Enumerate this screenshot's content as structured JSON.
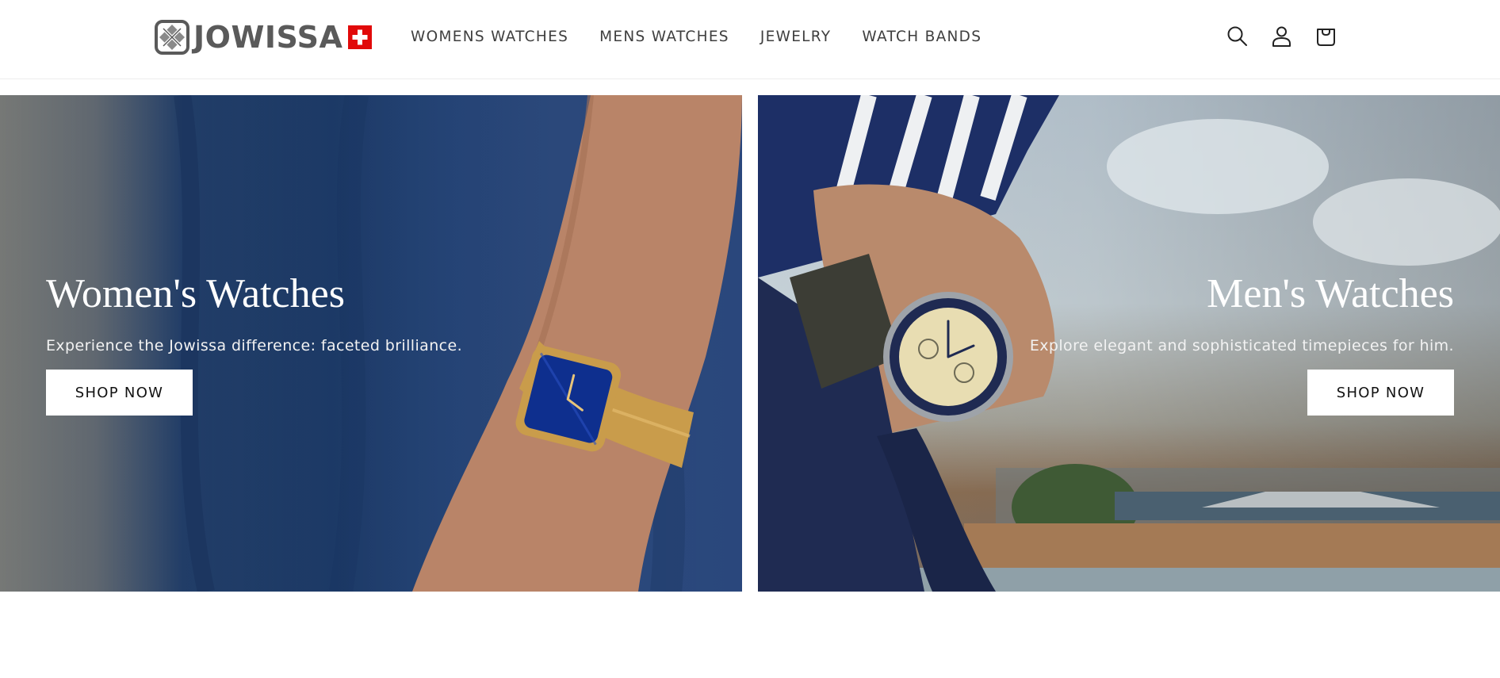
{
  "brand": {
    "name": "JOWISSA",
    "logo_icon": "crossed-diamond-logo",
    "flag_icon": "swiss-flag-icon",
    "flag_color": "#e10a0a",
    "logo_color": "#5a5a5a"
  },
  "nav": {
    "items": [
      {
        "label": "WOMENS WATCHES"
      },
      {
        "label": "MENS WATCHES"
      },
      {
        "label": "JEWELRY"
      },
      {
        "label": "WATCH BANDS"
      }
    ]
  },
  "header_icons": [
    "search-icon",
    "account-icon",
    "cart-icon"
  ],
  "hero": {
    "women": {
      "title": "Women's Watches",
      "subtitle": "Experience the Jowissa difference: faceted brilliance.",
      "button": "SHOP NOW"
    },
    "men": {
      "title": "Men's Watches",
      "subtitle": "Explore elegant and sophisticated timepieces for him.",
      "button": "SHOP NOW"
    }
  },
  "colors": {
    "text": "#121212",
    "nav_text": "#3f3f3f",
    "button_bg": "#ffffff",
    "hero_text": "#ffffff"
  }
}
